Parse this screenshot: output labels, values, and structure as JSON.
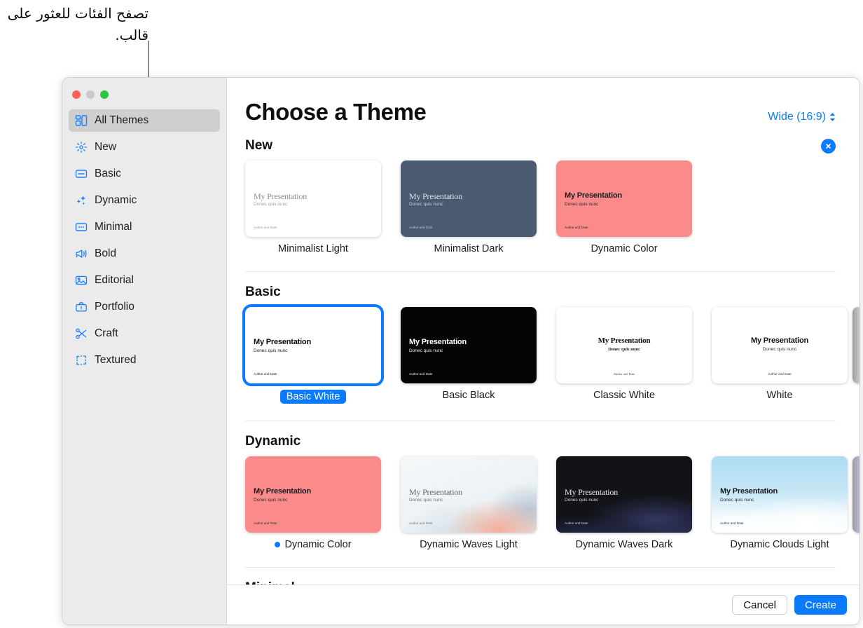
{
  "annotation": {
    "text": "تصفح الفئات للعثور على قالب."
  },
  "window": {
    "traffic_lights": [
      "close",
      "minimize",
      "zoom"
    ]
  },
  "sidebar": {
    "items": [
      {
        "label": "All Themes",
        "icon": "grid-squares-icon",
        "selected": true
      },
      {
        "label": "New",
        "icon": "sparkle-burst-icon",
        "selected": false
      },
      {
        "label": "Basic",
        "icon": "rectangle-line-icon",
        "selected": false
      },
      {
        "label": "Dynamic",
        "icon": "sparkles-icon",
        "selected": false
      },
      {
        "label": "Minimal",
        "icon": "rectangle-dots-icon",
        "selected": false
      },
      {
        "label": "Bold",
        "icon": "megaphone-icon",
        "selected": false
      },
      {
        "label": "Editorial",
        "icon": "photo-icon",
        "selected": false
      },
      {
        "label": "Portfolio",
        "icon": "briefcase-icon",
        "selected": false
      },
      {
        "label": "Craft",
        "icon": "scissors-icon",
        "selected": false
      },
      {
        "label": "Textured",
        "icon": "crop-frame-icon",
        "selected": false
      }
    ]
  },
  "header": {
    "title": "Choose a Theme",
    "aspect_ratio": "Wide (16:9)"
  },
  "thumbnail_text": {
    "title": "My Presentation",
    "subtitle": "Donec quis nunc",
    "footer": "Author and Date"
  },
  "sections": [
    {
      "title": "New",
      "has_close_badge": true,
      "peek": null,
      "themes": [
        {
          "name": "Minimalist Light",
          "skin": "sk-min-light",
          "centered": false,
          "selected": false,
          "dot": false
        },
        {
          "name": "Minimalist Dark",
          "skin": "sk-min-dark",
          "centered": false,
          "selected": false,
          "dot": false
        },
        {
          "name": "Dynamic Color",
          "skin": "sk-dyncolor",
          "centered": false,
          "selected": false,
          "dot": false
        }
      ]
    },
    {
      "title": "Basic",
      "has_close_badge": false,
      "peek": "sk-peek-gray",
      "themes": [
        {
          "name": "Basic White",
          "skin": "sk-basic-white",
          "centered": false,
          "selected": true,
          "dot": false
        },
        {
          "name": "Basic Black",
          "skin": "sk-basic-black",
          "centered": false,
          "selected": false,
          "dot": false
        },
        {
          "name": "Classic White",
          "skin": "sk-classic-white",
          "centered": true,
          "selected": false,
          "dot": false
        },
        {
          "name": "White",
          "skin": "sk-white",
          "centered": true,
          "selected": false,
          "dot": false
        }
      ]
    },
    {
      "title": "Dynamic",
      "has_close_badge": false,
      "peek": "sk-peek-purple",
      "themes": [
        {
          "name": "Dynamic Color",
          "skin": "sk-dyncolor",
          "centered": false,
          "selected": false,
          "dot": true
        },
        {
          "name": "Dynamic Waves Light",
          "skin": "sk-waves-light",
          "centered": false,
          "selected": false,
          "dot": false
        },
        {
          "name": "Dynamic Waves Dark",
          "skin": "sk-waves-dark",
          "centered": false,
          "selected": false,
          "dot": false
        },
        {
          "name": "Dynamic Clouds Light",
          "skin": "sk-clouds-light",
          "centered": false,
          "selected": false,
          "dot": false
        }
      ]
    },
    {
      "title": "Minimal",
      "has_close_badge": false,
      "peek": null,
      "themes": []
    }
  ],
  "footer": {
    "cancel_label": "Cancel",
    "create_label": "Create"
  },
  "colors": {
    "accent": "#0a7bff",
    "sidebar_bg": "#ebebeb",
    "selected_row_bg": "#cfcfcf",
    "icon_blue": "#1d7fff"
  }
}
